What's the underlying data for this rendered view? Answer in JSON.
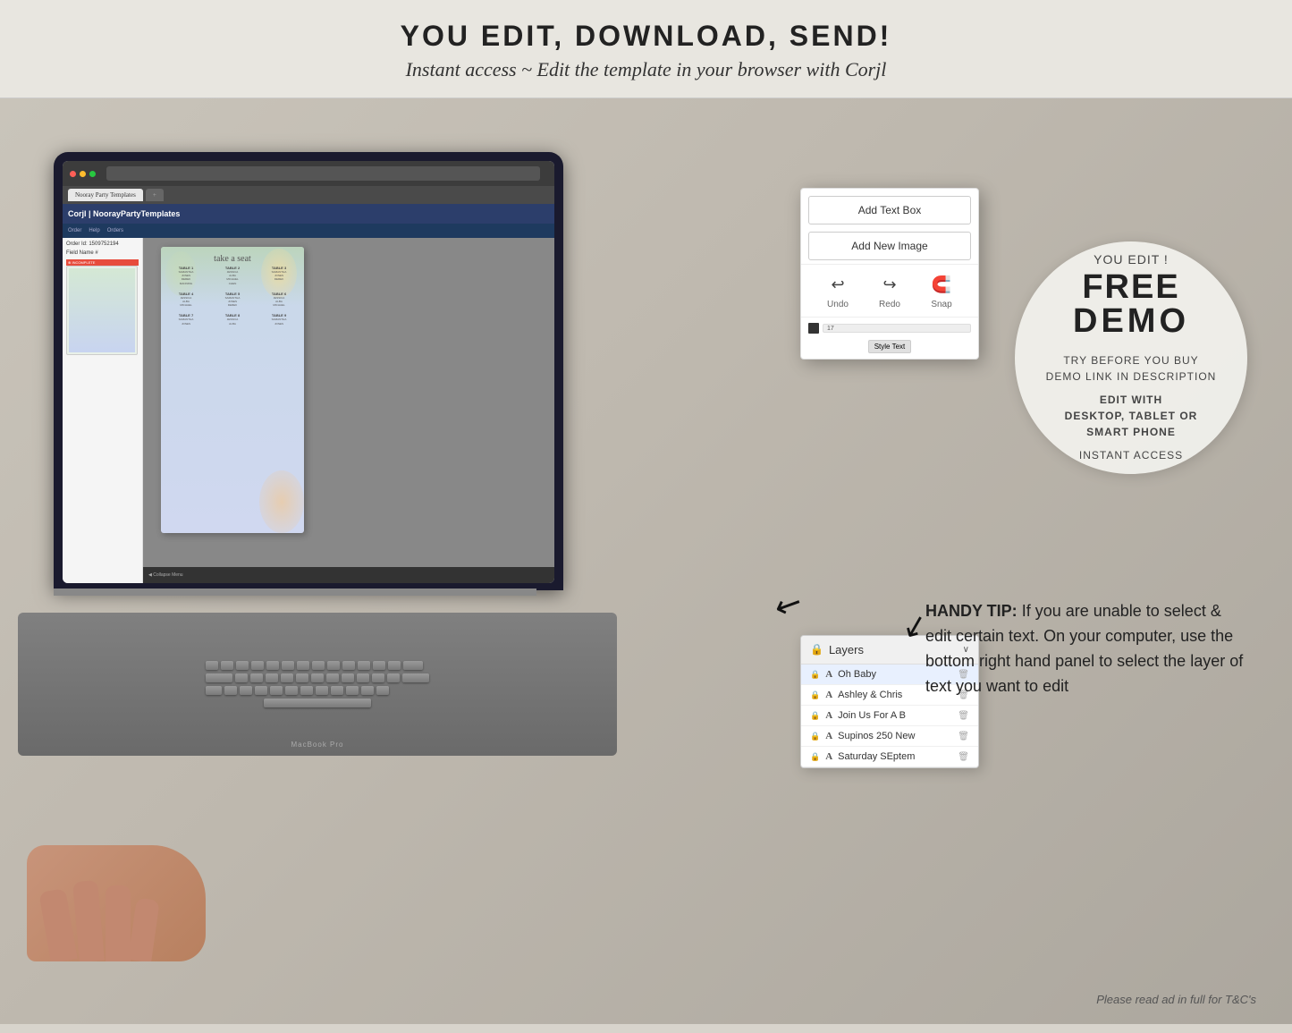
{
  "header": {
    "title": "YOU EDIT, DOWNLOAD, SEND!",
    "subtitle": "Instant access ~ Edit the template in your browser with Corjl"
  },
  "demo_circle": {
    "you_edit": "YOU EDIT !",
    "free": "FREE",
    "demo": "DEMO",
    "line1": "TRY BEFORE YOU BUY",
    "line2": "DEMO LINK IN DESCRIPTION",
    "line3": "EDIT WITH",
    "line4": "DESKTOP, TABLET OR",
    "line5": "SMART PHONE",
    "line6": "INSTANT ACCESS"
  },
  "corjl_popup": {
    "add_text_box": "Add Text Box",
    "add_new_image": "Add New Image",
    "undo": "Undo",
    "redo": "Redo",
    "snap": "Snap"
  },
  "layers_panel": {
    "title": "Layers",
    "items": [
      {
        "name": "Oh Baby",
        "type": "A",
        "selected": true
      },
      {
        "name": "Ashley & Chris",
        "type": "A",
        "selected": false
      },
      {
        "name": "Join Us For A B",
        "type": "A",
        "selected": false
      },
      {
        "name": "Supinos 250 New",
        "type": "A",
        "selected": false
      },
      {
        "name": "Saturday SEptem",
        "type": "A",
        "selected": false
      }
    ]
  },
  "handy_tip": {
    "bold_part": "HANDY TIP:",
    "text": " If you are unable to select & edit certain text. On your computer, use the bottom right hand panel to select the layer of text you want to edit"
  },
  "seating_chart": {
    "title": "take a seat",
    "tables": [
      {
        "header": "TABLE 1",
        "names": "SAMANTHA JONES\nDEREK MANNING\nCAROLINE SWIFT"
      },
      {
        "header": "TABLE 2",
        "names": "JESSICA ALBA\nMICHAEL CHEN\nOLIVIA PARKER"
      },
      {
        "header": "TABLE 3",
        "names": "SAMANTHA JONES\nDEREK MANNING\nCAROLINE SWIFT"
      },
      {
        "header": "TABLE 4",
        "names": "JESSICA ALBA\nMICHAEL CHEN\nOLIVIA PARKER"
      },
      {
        "header": "TABLE 5",
        "names": "SAMANTHA JONES\nDEREK MANNING"
      },
      {
        "header": "TABLE 6",
        "names": "JESSICA ALBA\nMICHAEL CHEN\nOLIVIA PARKER"
      },
      {
        "header": "TABLE 7",
        "names": "SAMANTHA JONES\nDEREK MANNING"
      },
      {
        "header": "TABLE 8",
        "names": "JESSICA ALBA\nMICHAEL CHEN"
      },
      {
        "header": "TABLE 9",
        "names": "SAMANTHA JONES\nDEREK MANNING"
      }
    ]
  },
  "disclaimer": "Please read ad in full for T&C's",
  "macbook_label": "MacBook Pro"
}
